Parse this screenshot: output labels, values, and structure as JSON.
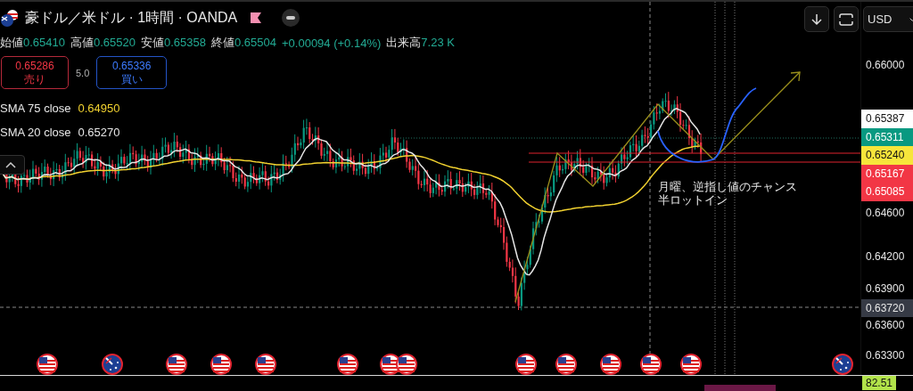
{
  "header": {
    "title": "豪ドル／米ドル · 1時間 · OANDA"
  },
  "ohlc": [
    {
      "label": "始値",
      "value": "0.65410"
    },
    {
      "label": "高値",
      "value": "0.65520"
    },
    {
      "label": "安値",
      "value": "0.65358"
    },
    {
      "label": "終値",
      "value": "0.65504"
    }
  ],
  "change": "+0.00094 (+0.14%)",
  "volume": {
    "label": "出来高",
    "value": "7.23 K"
  },
  "trade": {
    "sell": {
      "price": "0.65286",
      "label": "売り"
    },
    "spread": "5.0",
    "buy": {
      "price": "0.65336",
      "label": "買い"
    }
  },
  "indicators": [
    {
      "name": "SMA 75 close",
      "value": "0.64950",
      "color": "#f2d230"
    },
    {
      "name": "SMA 20 close",
      "value": "0.65270",
      "color": "#e6e6e6"
    }
  ],
  "toolbar": {
    "currency": "USD"
  },
  "annotation": [
    "月曜、逆指し値のチャンス",
    "半ロットイン"
  ],
  "price_axis": {
    "ticks": [
      "0.66000",
      "0.64600",
      "0.64200",
      "0.63900",
      "0.63600",
      "0.63300"
    ],
    "badges": [
      {
        "text": "0.65387",
        "color": "#ffffff"
      },
      {
        "text": "0.65311",
        "color": "#089981"
      },
      {
        "text": "0.65240",
        "color": "#f7e53b"
      },
      {
        "text": "0.65167",
        "color": "#f23645"
      },
      {
        "text": "0.65085",
        "color": "#f23645"
      }
    ],
    "crosshair_label": "0.63720"
  },
  "lower_pane": {
    "value": "82.51"
  }
}
